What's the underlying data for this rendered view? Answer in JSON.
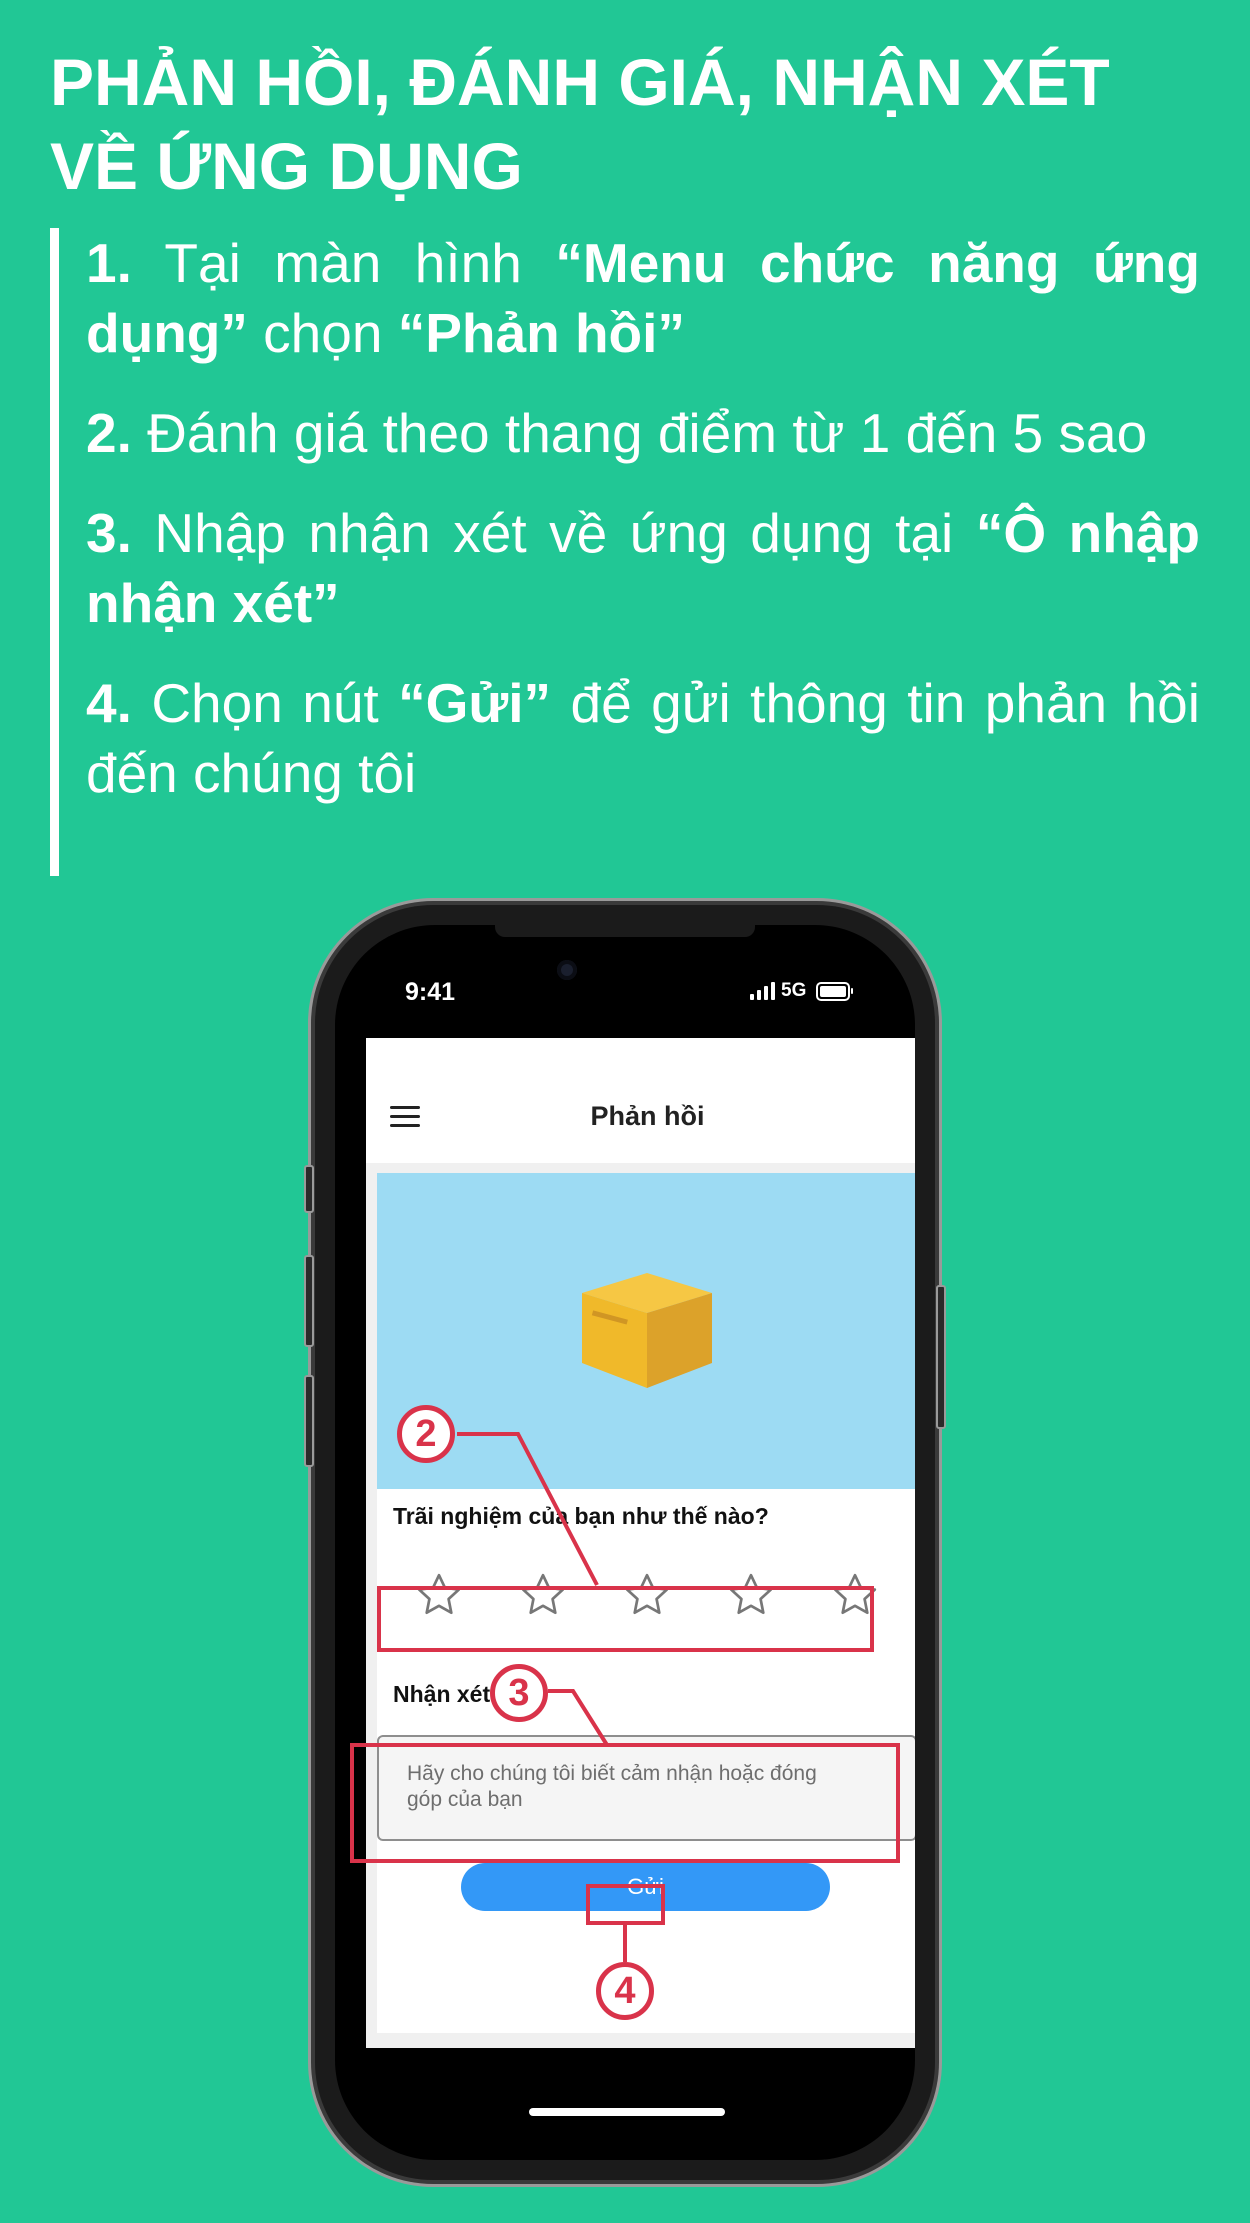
{
  "heading": {
    "line1": "PHẢN HỒI, ĐÁNH GIÁ, NHẬN XÉT",
    "line2": "VỀ ỨNG DỤNG"
  },
  "steps": [
    {
      "num": "1.",
      "parts": [
        {
          "text": " Tại màn hình ",
          "bold": false
        },
        {
          "text": "“Menu chức năng ứng dụng”",
          "bold": true
        },
        {
          "text": " chọn ",
          "bold": false
        },
        {
          "text": "“Phản hồi”",
          "bold": true
        }
      ]
    },
    {
      "num": "2.",
      "parts": [
        {
          "text": " Đánh giá theo thang điểm từ 1 đến 5 sao",
          "bold": false
        }
      ]
    },
    {
      "num": "3.",
      "parts": [
        {
          "text": " Nhập nhận xét về ứng dụng tại ",
          "bold": false
        },
        {
          "text": "“Ô nhập nhận xét”",
          "bold": true
        }
      ]
    },
    {
      "num": "4.",
      "parts": [
        {
          "text": " Chọn nút ",
          "bold": false
        },
        {
          "text": "“Gửi”",
          "bold": true
        },
        {
          "text": " để gửi thông tin phản hồi đến chúng tôi",
          "bold": false
        }
      ]
    }
  ],
  "phone": {
    "status_time": "9:41",
    "network": "5G",
    "app_title": "Phản hồi",
    "question": "Trãi nghiệm của bạn như thế nào?",
    "rating": {
      "value": 0,
      "max": 5
    },
    "comment_label": "Nhận xét",
    "comment_placeholder": "Hãy cho chúng tôi biết cảm nhận hoặc đóng góp của bạn",
    "submit_label": "Gửi"
  },
  "annotations": [
    "2",
    "3",
    "4"
  ],
  "colors": {
    "background": "#21c795",
    "accent_red": "#d9334a",
    "button_blue": "#3398f7",
    "banner_blue": "#9ddbf3",
    "box_yellow": "#f0b92a"
  },
  "icons": {
    "menu": "hamburger-icon",
    "star": "star-outline-icon",
    "banner": "box-icon"
  }
}
